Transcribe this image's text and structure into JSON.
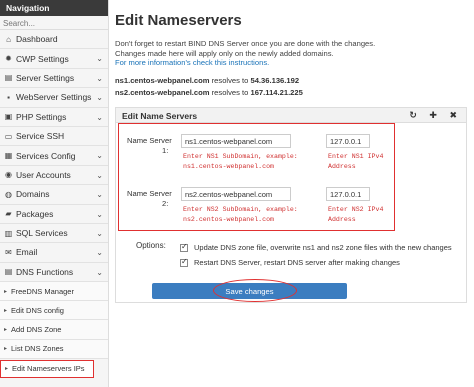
{
  "sidebar": {
    "header": "Navigation",
    "search_placeholder": "Search...",
    "items": [
      {
        "label": "Dashboard",
        "icon": "home-icon",
        "glyph": "⌂",
        "chevron": false
      },
      {
        "label": "CWP Settings",
        "icon": "gear-icon",
        "glyph": "✹",
        "chevron": true
      },
      {
        "label": "Server Settings",
        "icon": "server-icon",
        "glyph": "▤",
        "chevron": true
      },
      {
        "label": "WebServer Settings",
        "icon": "webserver-icon",
        "glyph": "▪",
        "chevron": true
      },
      {
        "label": "PHP Settings",
        "icon": "php-icon",
        "glyph": "▣",
        "chevron": true
      },
      {
        "label": "Service SSH",
        "icon": "terminal-icon",
        "glyph": "▭",
        "chevron": false
      },
      {
        "label": "Services Config",
        "icon": "config-icon",
        "glyph": "▦",
        "chevron": true
      },
      {
        "label": "User Accounts",
        "icon": "user-icon",
        "glyph": "◉",
        "chevron": true
      },
      {
        "label": "Domains",
        "icon": "globe-icon",
        "glyph": "◍",
        "chevron": true
      },
      {
        "label": "Packages",
        "icon": "package-icon",
        "glyph": "▰",
        "chevron": true
      },
      {
        "label": "SQL Services",
        "icon": "database-icon",
        "glyph": "▥",
        "chevron": true
      },
      {
        "label": "Email",
        "icon": "envelope-icon",
        "glyph": "✉",
        "chevron": true
      },
      {
        "label": "DNS Functions",
        "icon": "dns-icon",
        "glyph": "▤",
        "chevron": true
      }
    ],
    "sub_items": [
      {
        "label": "FreeDNS Manager"
      },
      {
        "label": "Edit DNS config"
      },
      {
        "label": "Add DNS Zone"
      },
      {
        "label": "List DNS Zones"
      },
      {
        "label": "Edit Nameservers IPs"
      }
    ]
  },
  "main": {
    "title": "Edit Nameservers",
    "desc_line1": "Don't forget to restart BIND DNS Server once you are done with the changes.",
    "desc_line2": "Changes made here will apply only on the newly added domains.",
    "desc_link": "For more information's check this instructions.",
    "resolve1": {
      "ns": "ns1.centos-webpanel.com",
      "text": " resolves to ",
      "ip": "54.36.136.192"
    },
    "resolve2": {
      "ns": "ns2.centos-webpanel.com",
      "text": " resolves to ",
      "ip": "167.114.21.225"
    }
  },
  "panel": {
    "title": "Edit Name Servers",
    "tools": "↻ ✚ ✖",
    "ns1": {
      "label_line1": "Name Server",
      "label_line2": "1:",
      "value": "ns1.centos-webpanel.com",
      "ip": "127.0.0.1",
      "hint_line1": "Enter NS1 SubDomain, example:",
      "hint_line2": "ns1.centos-webpanel.com",
      "ip_hint_line1": "Enter NS1 IPv4",
      "ip_hint_line2": "Address"
    },
    "ns2": {
      "label_line1": "Name Server",
      "label_line2": "2:",
      "value": "ns2.centos-webpanel.com",
      "ip": "127.0.0.1",
      "hint_line1": "Enter NS2 SubDomain, example:",
      "hint_line2": "ns2.centos-webpanel.com",
      "ip_hint_line1": "Enter NS2 IPv4",
      "ip_hint_line2": "Address"
    },
    "options_label": "Options:",
    "option1": "Update DNS zone file, overwrite ns1 and ns2 zone files with the new changes",
    "option2": "Restart DNS Server, restart DNS server after making changes",
    "save_label": "Save changes"
  },
  "colors": {
    "accent": "#3b7dc0",
    "highlight": "#e03030",
    "nav_header": "#3a3a3a"
  }
}
